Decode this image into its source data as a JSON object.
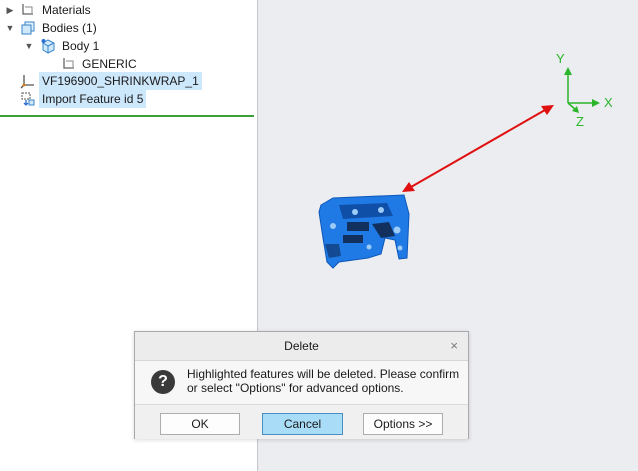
{
  "tree": {
    "items": [
      {
        "label": "Materials",
        "icon": "materials-icon",
        "caret": "▶"
      },
      {
        "label": "Bodies (1)",
        "icon": "bodies-icon",
        "caret": "▼"
      },
      {
        "label": "Body 1",
        "icon": "body-icon",
        "caret": "▼"
      },
      {
        "label": "GENERIC",
        "icon": "material-generic-icon",
        "caret": ""
      },
      {
        "label": "VF196900_SHRINKWRAP_1",
        "icon": "csys-icon",
        "caret": ""
      },
      {
        "label": "Import Feature id 5",
        "icon": "import-feature-icon",
        "caret": ""
      }
    ]
  },
  "viewport": {
    "axes": {
      "x": "X",
      "y": "Y",
      "z": "Z"
    },
    "colors": {
      "axis": "#2bb52b",
      "arrow": "#e01010",
      "model": "#1f7ae6"
    }
  },
  "dialog": {
    "title": "Delete",
    "close": "×",
    "icon": "?",
    "message": "Highlighted features will be deleted. Please confirm or select \"Options\" for advanced options.",
    "buttons": {
      "ok": "OK",
      "cancel": "Cancel",
      "options": "Options >>"
    }
  }
}
